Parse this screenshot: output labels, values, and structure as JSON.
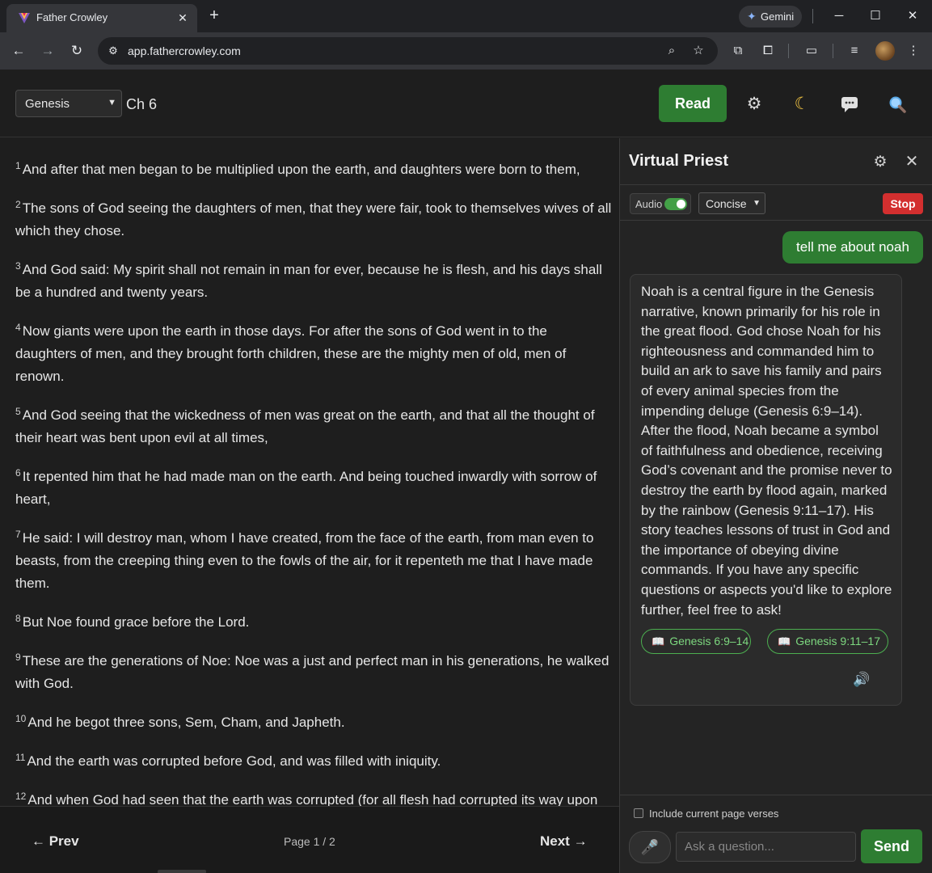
{
  "browser": {
    "tab_title": "Father Crowley",
    "url": "app.fathercrowley.com",
    "gemini_label": "Gemini",
    "icons": {
      "favicon": "vuetify-logo-icon",
      "close_tab": "close-icon",
      "new_tab": "plus-icon",
      "gemini": "gemini-star-icon",
      "minimize": "minimize-icon",
      "maximize": "maximize-icon",
      "close_window": "close-icon",
      "back": "arrow-left-icon",
      "forward": "arrow-right-icon",
      "reload": "reload-icon",
      "site_info": "tune-icon",
      "zoom": "zoom-icon",
      "bookmark": "star-icon",
      "extension_zip": "zip-extension-icon",
      "extensions": "puzzle-icon",
      "tab_search": "tab-search-icon",
      "reading_list": "media-list-icon",
      "profile": "avatar",
      "menu": "kebab-menu-icon"
    }
  },
  "header": {
    "book": "Genesis",
    "chapter": "Ch 6",
    "read_label": "Read",
    "icons": [
      "gear-icon",
      "moon-icon",
      "chat-icon",
      "search-icon"
    ]
  },
  "verses": [
    {
      "num": "1",
      "lines": [
        "And after that men began to be multiplied upon the earth, and daughters were born to them,"
      ]
    },
    {
      "num": "2",
      "lines": [
        "The sons of God seeing the daughters of men, that they were fair, took to themselves wives of all",
        "which they chose."
      ]
    },
    {
      "num": "3",
      "lines": [
        "And God said: My spirit shall not remain in man for ever, because he is flesh, and his days shall",
        "be a hundred and twenty years."
      ]
    },
    {
      "num": "4",
      "lines": [
        "Now giants were upon the earth in those days. For after the sons of God went in to the",
        "daughters of men, and they brought forth children, these are the mighty men of old, men of",
        "renown."
      ]
    },
    {
      "num": "5",
      "lines": [
        "And God seeing that the wickedness of men was great on the earth, and that all the thought of",
        "their heart was bent upon evil at all times,"
      ]
    },
    {
      "num": "6",
      "lines": [
        "It repented him that he had made man on the earth. And being touched inwardly with sorrow of",
        "heart,"
      ]
    },
    {
      "num": "7",
      "lines": [
        "He said: I will destroy man, whom I have created, from the face of the earth, from man even to",
        "beasts, from the creeping thing even to the fowls of the air, for it repenteth me that I have made",
        "them."
      ]
    },
    {
      "num": "8",
      "lines": [
        "But Noe found grace before the Lord."
      ]
    },
    {
      "num": "9",
      "lines": [
        "These are the generations of Noe: Noe was a just and perfect man in his generations, he walked",
        "with God."
      ]
    },
    {
      "num": "10",
      "lines": [
        "And he begot three sons, Sem, Cham, and Japheth."
      ]
    },
    {
      "num": "11",
      "lines": [
        "And the earth was corrupted before God, and was filled with iniquity."
      ]
    },
    {
      "num": "12",
      "lines": [
        "And when God had seen that the earth was corrupted (for all flesh had corrupted its way upon"
      ]
    }
  ],
  "pager": {
    "prev": "← Prev",
    "page": "Page 1 / 2",
    "next": "Next →"
  },
  "chat": {
    "title": "Virtual Priest",
    "audio_label": "Audio",
    "audio_on": true,
    "mode": "Concise",
    "stop_label": "Stop",
    "user_message": "tell me about noah",
    "bot_message": "Noah is a central figure in the Genesis narrative, known primarily for his role in the great flood. God chose Noah for his righteousness and commanded him to build an ark to save his family and pairs of every animal species from the impending deluge (Genesis 6:9–14). After the flood, Noah became a symbol of faithfulness and obedience, receiving God’s covenant and the promise never to destroy the earth by flood again, marked by the rainbow (Genesis 9:11–17). His story teaches lessons of trust in God and the importance of obeying divine commands. If you have any specific questions or aspects you'd like to explore further, feel free to ask!",
    "refs": [
      "Genesis 6:9–14",
      "Genesis 9:11–17"
    ],
    "include_label": "Include current page verses",
    "input_placeholder": "Ask a question...",
    "send_label": "Send",
    "colors": {
      "accent": "#2e7d32",
      "stop": "#d32f2f",
      "chip": "#4caf50"
    }
  }
}
